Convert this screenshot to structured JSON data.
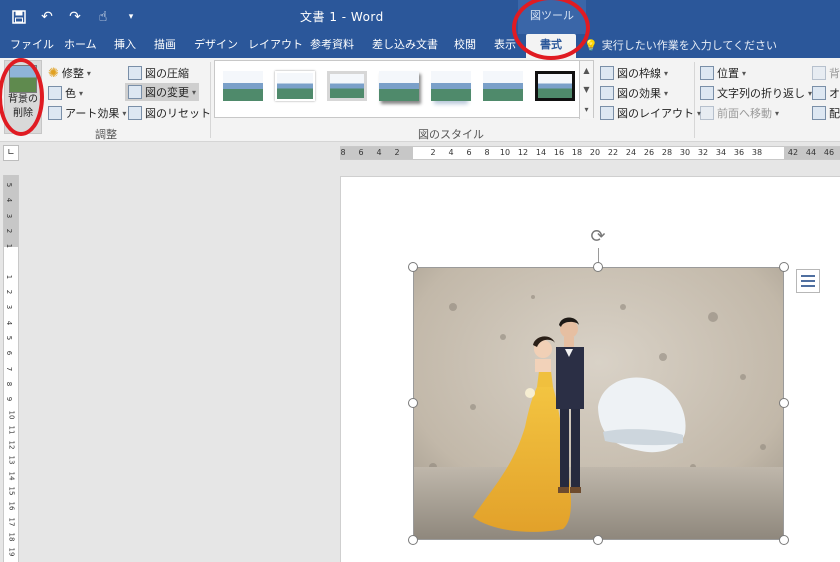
{
  "window": {
    "doc_title": "文書 1 - Word",
    "context_tab_title": "図ツール"
  },
  "qat": {
    "save_icon": "save-icon",
    "undo_icon": "undo-icon",
    "redo_icon": "redo-icon",
    "touch_icon": "touch-mode-icon",
    "customize_icon": "customize-qat-icon"
  },
  "tabs": [
    "ファイル",
    "ホーム",
    "挿入",
    "描画",
    "デザイン",
    "レイアウト",
    "参考資料",
    "差し込み文書",
    "校閲",
    "表示",
    "書式"
  ],
  "active_tab": "書式",
  "tell_me": "実行したい作業を入力してください",
  "ribbon": {
    "remove_bg": "背景の削除",
    "adjust_group": "調整",
    "corrections": "修整",
    "color": "色",
    "artistic": "アート効果",
    "compress": "図の圧縮",
    "change": "図の変更",
    "reset": "図のリセット",
    "styles_group": "図のスタイル",
    "border": "図の枠線",
    "effects": "図の効果",
    "layout": "図のレイアウト",
    "position": "位置",
    "wrap": "文字列の折り返し",
    "bring_forward": "前面へ移動",
    "send_backward": "背",
    "selection_pane": "オ",
    "align": "配"
  },
  "ruler": {
    "h_ticks": [
      "8",
      "6",
      "4",
      "2",
      "",
      "2",
      "4",
      "6",
      "8",
      "10",
      "12",
      "14",
      "16",
      "18",
      "20",
      "22",
      "24",
      "26",
      "28",
      "30",
      "32",
      "34",
      "36",
      "38",
      "",
      "42",
      "44",
      "46"
    ],
    "v_ticks": [
      "5",
      "4",
      "3",
      "2",
      "1",
      "",
      "1",
      "2",
      "3",
      "4",
      "5",
      "6",
      "7",
      "8",
      "9",
      "10",
      "11",
      "12",
      "13",
      "14",
      "15",
      "16",
      "17",
      "18",
      "19"
    ]
  },
  "colors": {
    "titlebar": "#2b579a",
    "annotation": "#e01b22",
    "ribbon": "#f3f3f3"
  }
}
